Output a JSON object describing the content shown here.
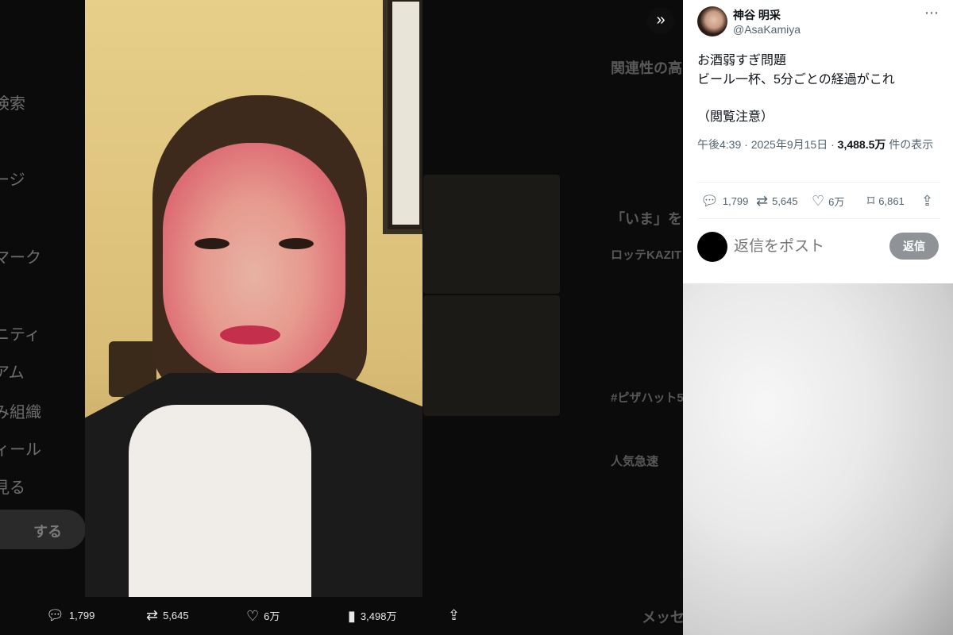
{
  "background_nav": {
    "items": [
      {
        "label": "検索"
      },
      {
        "label": "ージ"
      },
      {
        "label": "マーク"
      },
      {
        "label": "ニティ"
      },
      {
        "label": "アム"
      },
      {
        "label": "み組織"
      },
      {
        "label": "ィール"
      },
      {
        "label": "見る"
      }
    ],
    "post_button": "する"
  },
  "background_right": {
    "related_header": "関連性の高",
    "trends_header": "「いま」を",
    "trend_1": "ロッテKAZIT",
    "trend_2": "#ピザハット5",
    "trend_3": "人気急速",
    "messages": "メッセ"
  },
  "media_actions": {
    "replies": "1,799",
    "reposts": "5,645",
    "likes": "6万",
    "views": "3,498万"
  },
  "tweet": {
    "display_name": "神谷 明采",
    "handle": "@AsaKamiya",
    "more_icon": "⋯",
    "text_lines": [
      "お酒弱すぎ問題",
      "ビール一杯、5分ごとの経過がこれ",
      "（閲覧注意）"
    ],
    "time": "午後4:39",
    "date": "2025年9月15日",
    "views_count": "3,488.5万",
    "views_suffix": "件の表示",
    "separator": "·"
  },
  "tweet_actions": {
    "replies": "1,799",
    "reposts": "5,645",
    "likes": "6万",
    "bookmarks": "6,861"
  },
  "reply": {
    "placeholder": "返信をポスト",
    "button": "返信"
  }
}
